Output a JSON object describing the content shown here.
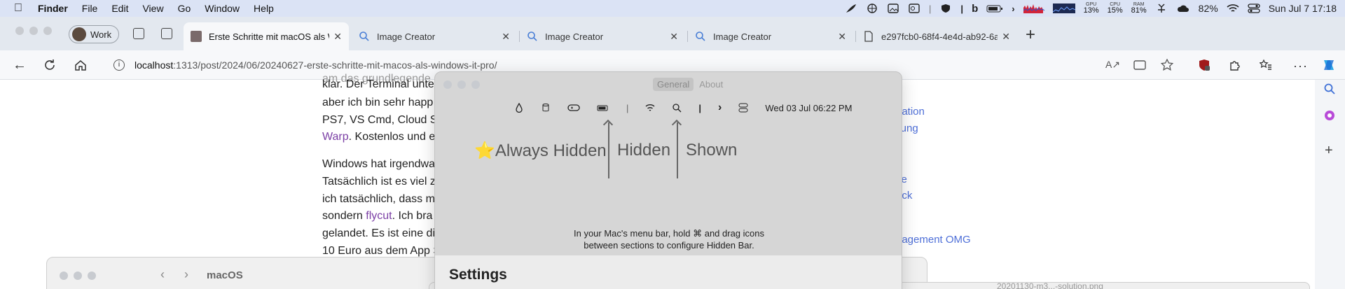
{
  "menubar": {
    "items": [
      "Finder",
      "File",
      "Edit",
      "View",
      "Go",
      "Window",
      "Help"
    ],
    "stats": [
      {
        "key": "GPU",
        "value": "13%"
      },
      {
        "key": "CPU",
        "value": "15%"
      },
      {
        "key": "RAM",
        "value": "81%"
      }
    ],
    "battery": "82%",
    "clock": "Sun Jul 7  17:18"
  },
  "browser": {
    "profile": "Work",
    "tabs": [
      {
        "title": "Erste Schritte mit macOS als Wi",
        "active": true
      },
      {
        "title": "Image Creator"
      },
      {
        "title": "Image Creator"
      },
      {
        "title": "Image Creator"
      },
      {
        "title": "e297fcb0-68f4-4e4d-ab92-6a"
      }
    ],
    "url_host": "localhost",
    "url_path": ":1313/post/2024/06/20240627-erste-schritte-mit-macos-als-windows-it-pro/"
  },
  "article": {
    "lines": [
      "klar. Der Terminal unte",
      "aber ich bin sehr happ",
      "PS7, VS Cmd, Cloud S",
      "Warp",
      ". Kostenlos und e",
      "Windows hat irgendwa",
      "Tatsächlich ist es viel z",
      "ich tatsächlich, dass m",
      "sondern ",
      "flycut",
      ". Ich bra",
      "gelandet. Es ist eine di",
      "10 Euro aus dem App S"
    ],
    "toc": [
      "uation",
      "llung",
      "ce",
      "ock",
      "nagement OMG"
    ]
  },
  "finder": {
    "title": "macOS"
  },
  "hiddenbar": {
    "tabs": [
      "General",
      "About"
    ],
    "mini_date": "Wed 03 Jul 06:22 PM",
    "sections": [
      "Always Hidden",
      "Hidden",
      "Shown"
    ],
    "star": "⭐",
    "instruction_line1": "In your Mac's menu bar, hold ⌘ and drag icons",
    "instruction_line2": "between sections to configure Hidden Bar.",
    "settings_heading": "Settings"
  },
  "bottom_window": {
    "filename": "20201130-m3...-solution.png"
  }
}
